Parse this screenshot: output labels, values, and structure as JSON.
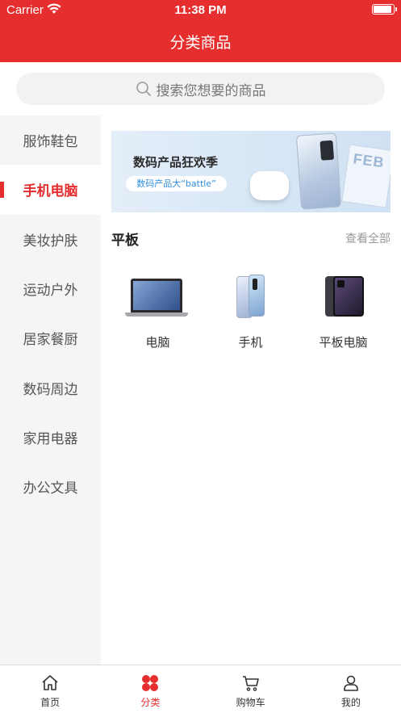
{
  "status_bar": {
    "carrier": "Carrier",
    "time": "11:38 PM"
  },
  "nav": {
    "title": "分类商品"
  },
  "search": {
    "placeholder": "搜索您想要的商品"
  },
  "sidebar": {
    "items": [
      {
        "label": "服饰鞋包",
        "active": false
      },
      {
        "label": "手机电脑",
        "active": true
      },
      {
        "label": "美妆护肤",
        "active": false
      },
      {
        "label": "运动户外",
        "active": false
      },
      {
        "label": "居家餐厨",
        "active": false
      },
      {
        "label": "数码周边",
        "active": false
      },
      {
        "label": "家用电器",
        "active": false
      },
      {
        "label": "办公文具",
        "active": false
      }
    ]
  },
  "banner": {
    "title": "数码产品狂欢季",
    "subtitle": "数码产品大“battle”",
    "calendar_text": "FEB"
  },
  "section": {
    "title": "平板",
    "view_all": "查看全部"
  },
  "products": [
    {
      "label": "电脑",
      "icon": "laptop-image"
    },
    {
      "label": "手机",
      "icon": "phone-image"
    },
    {
      "label": "平板电脑",
      "icon": "tablet-image"
    }
  ],
  "tabbar": {
    "items": [
      {
        "label": "首页",
        "icon": "home-icon",
        "active": false
      },
      {
        "label": "分类",
        "icon": "category-icon",
        "active": true
      },
      {
        "label": "购物车",
        "icon": "cart-icon",
        "active": false
      },
      {
        "label": "我的",
        "icon": "profile-icon",
        "active": false
      }
    ]
  },
  "colors": {
    "brand": "#e62e2e",
    "sidebar_bg": "#f5f5f7",
    "search_bg": "#f2f2f4"
  }
}
